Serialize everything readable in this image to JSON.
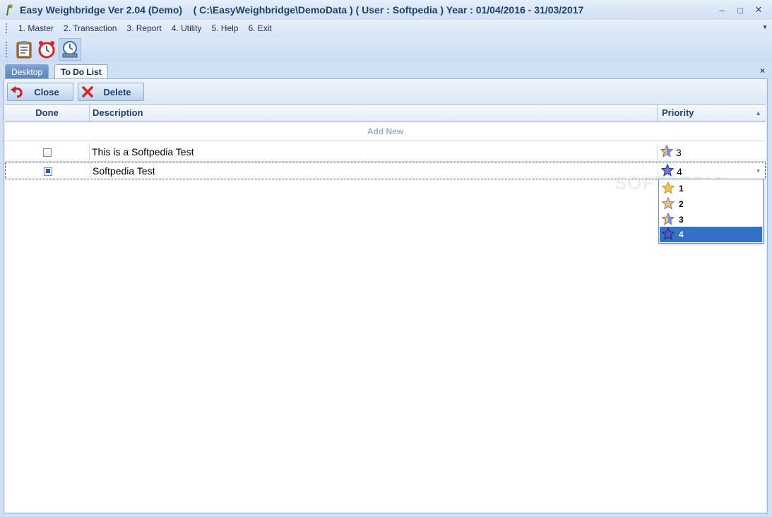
{
  "window": {
    "title": "Easy Weighbridge Ver 2.04 (Demo)    ( C:\\EasyWeighbridge\\DemoData ) ( User : Softpedia ) Year : 01/04/2016 - 31/03/2017",
    "minimize": "–",
    "maximize": "□",
    "close": "✕"
  },
  "menu": [
    {
      "label": "1. Master"
    },
    {
      "label": "2. Transaction"
    },
    {
      "label": "3. Report"
    },
    {
      "label": "4. Utility"
    },
    {
      "label": "5. Help"
    },
    {
      "label": "6. Exit"
    }
  ],
  "toolbar": {
    "icons": [
      "clipboard-icon",
      "alarm-clock-icon",
      "backup-icon"
    ]
  },
  "tabs": [
    {
      "label": "Desktop",
      "active": false
    },
    {
      "label": "To Do List",
      "active": true
    }
  ],
  "tab_close": "×",
  "actions": {
    "close_label": "Close",
    "delete_label": "Delete"
  },
  "grid": {
    "columns": [
      "Done",
      "Description",
      "Priority"
    ],
    "sort_indicator": "▲",
    "add_new": "Add New",
    "rows": [
      {
        "done": false,
        "description": "This is a Softpedia Test",
        "priority": "3"
      },
      {
        "done": true,
        "description": "Softpedia Test",
        "priority": "4"
      }
    ]
  },
  "priority_dropdown": {
    "options": [
      "1",
      "2",
      "3",
      "4"
    ],
    "selected": "4"
  },
  "watermark": "SOFTPEDIA",
  "colors": {
    "accent": "#3470c6",
    "title_text": "#1e3f6e",
    "star_gold": "#f5c35a",
    "star_blue": "#5b6fc7"
  }
}
